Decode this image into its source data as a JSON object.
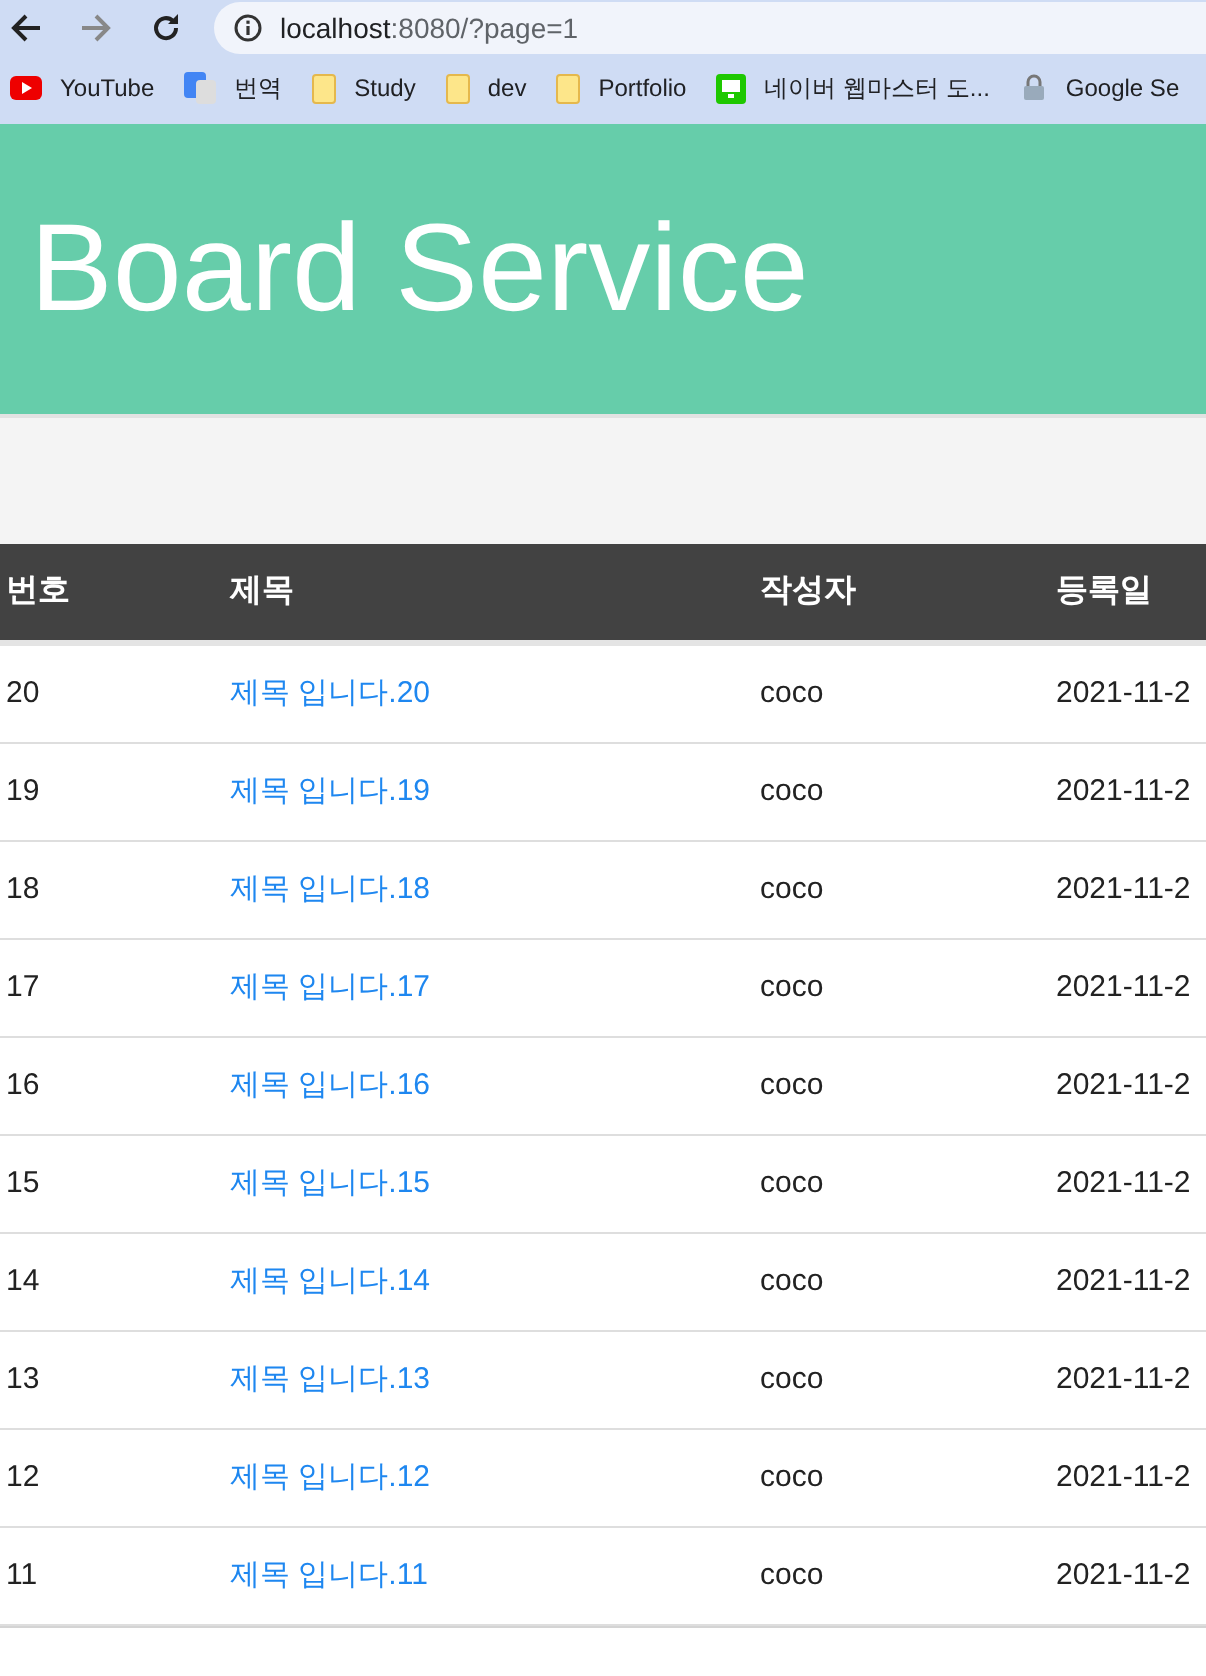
{
  "browser": {
    "address": {
      "host": "localhost",
      "path": ":8080/?page=1"
    },
    "bookmarks": [
      {
        "label": "YouTube",
        "kind": "youtube"
      },
      {
        "label": "번역",
        "kind": "translate"
      },
      {
        "label": "Study",
        "kind": "folder"
      },
      {
        "label": "dev",
        "kind": "folder"
      },
      {
        "label": "Portfolio",
        "kind": "folder"
      },
      {
        "label": "네이버 웹마스터 도...",
        "kind": "monitor"
      },
      {
        "label": "Google Se",
        "kind": "lock"
      }
    ]
  },
  "header": {
    "title": "Board Service"
  },
  "table": {
    "columns": [
      "번호",
      "제목",
      "작성자",
      "등록일"
    ],
    "rows": [
      {
        "no": "20",
        "title": "제목 입니다.20",
        "writer": "coco",
        "date": "2021-11-2"
      },
      {
        "no": "19",
        "title": "제목 입니다.19",
        "writer": "coco",
        "date": "2021-11-2"
      },
      {
        "no": "18",
        "title": "제목 입니다.18",
        "writer": "coco",
        "date": "2021-11-2"
      },
      {
        "no": "17",
        "title": "제목 입니다.17",
        "writer": "coco",
        "date": "2021-11-2"
      },
      {
        "no": "16",
        "title": "제목 입니다.16",
        "writer": "coco",
        "date": "2021-11-2"
      },
      {
        "no": "15",
        "title": "제목 입니다.15",
        "writer": "coco",
        "date": "2021-11-2"
      },
      {
        "no": "14",
        "title": "제목 입니다.14",
        "writer": "coco",
        "date": "2021-11-2"
      },
      {
        "no": "13",
        "title": "제목 입니다.13",
        "writer": "coco",
        "date": "2021-11-2"
      },
      {
        "no": "12",
        "title": "제목 입니다.12",
        "writer": "coco",
        "date": "2021-11-2"
      },
      {
        "no": "11",
        "title": "제목 입니다.11",
        "writer": "coco",
        "date": "2021-11-2"
      }
    ]
  }
}
